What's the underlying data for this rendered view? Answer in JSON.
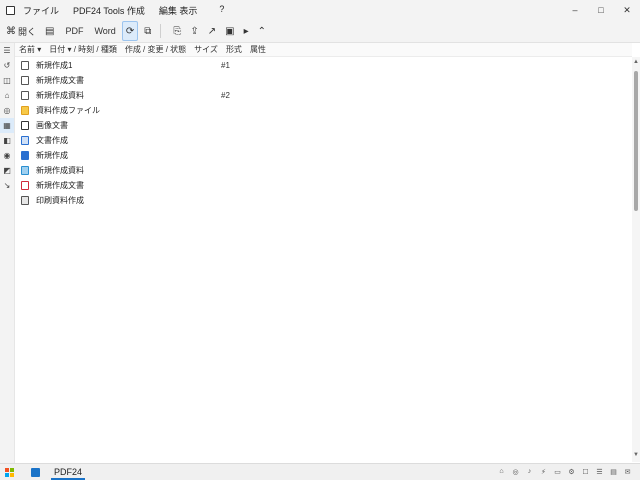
{
  "titlebar": {
    "menu": [
      "ファイル",
      "PDF24 Tools 作成",
      "編集 表示",
      "?"
    ],
    "min": "–",
    "max": "□",
    "close": "✕"
  },
  "toolbar": {
    "open_text": "開く",
    "pdf_text": "PDF",
    "word_text": "Word",
    "buttons": [
      "⌘",
      "▤",
      "✉",
      "⟳",
      "⧉",
      "⎘",
      "⇪",
      "↗",
      "▣",
      "▸",
      "⌃"
    ]
  },
  "header": {
    "cols": [
      "名前 ▾",
      "日付 ▾ / 時刻 / 種類",
      "作成 / 変更 / 状態",
      "サイズ",
      "形式",
      "属性"
    ]
  },
  "rail": [
    "☰",
    "↺",
    "◫",
    "⌂",
    "◎",
    "▦",
    "◧",
    "◉",
    "◩",
    "↘"
  ],
  "files": [
    {
      "name": "新規作成1",
      "val": "#1",
      "color": "#555555"
    },
    {
      "name": "新規作成文書",
      "val": "",
      "color": "#555555"
    },
    {
      "name": "新規作成資料",
      "val": "#2",
      "color": "#555555"
    },
    {
      "name": "資料作成ファイル",
      "val": "",
      "color": "#e0a020"
    },
    {
      "name": "画像文書",
      "val": "",
      "color": "#333333"
    },
    {
      "name": "文書作成",
      "val": "",
      "color": "#2a6fd0"
    },
    {
      "name": "新規作成",
      "val": "",
      "color": "#2a6fd0"
    },
    {
      "name": "新規作成資料",
      "val": "",
      "color": "#2a8fd0"
    },
    {
      "name": "新規作成文書",
      "val": "",
      "color": "#d02a3a"
    },
    {
      "name": "印刷資料作成",
      "val": "",
      "color": "#555555"
    }
  ],
  "taskbar": {
    "label": "PDF24",
    "tray": [
      "⌂",
      "◎",
      "♪",
      "⚡",
      "▭",
      "⚙",
      "☐",
      "☰",
      "▤",
      "✉"
    ]
  }
}
